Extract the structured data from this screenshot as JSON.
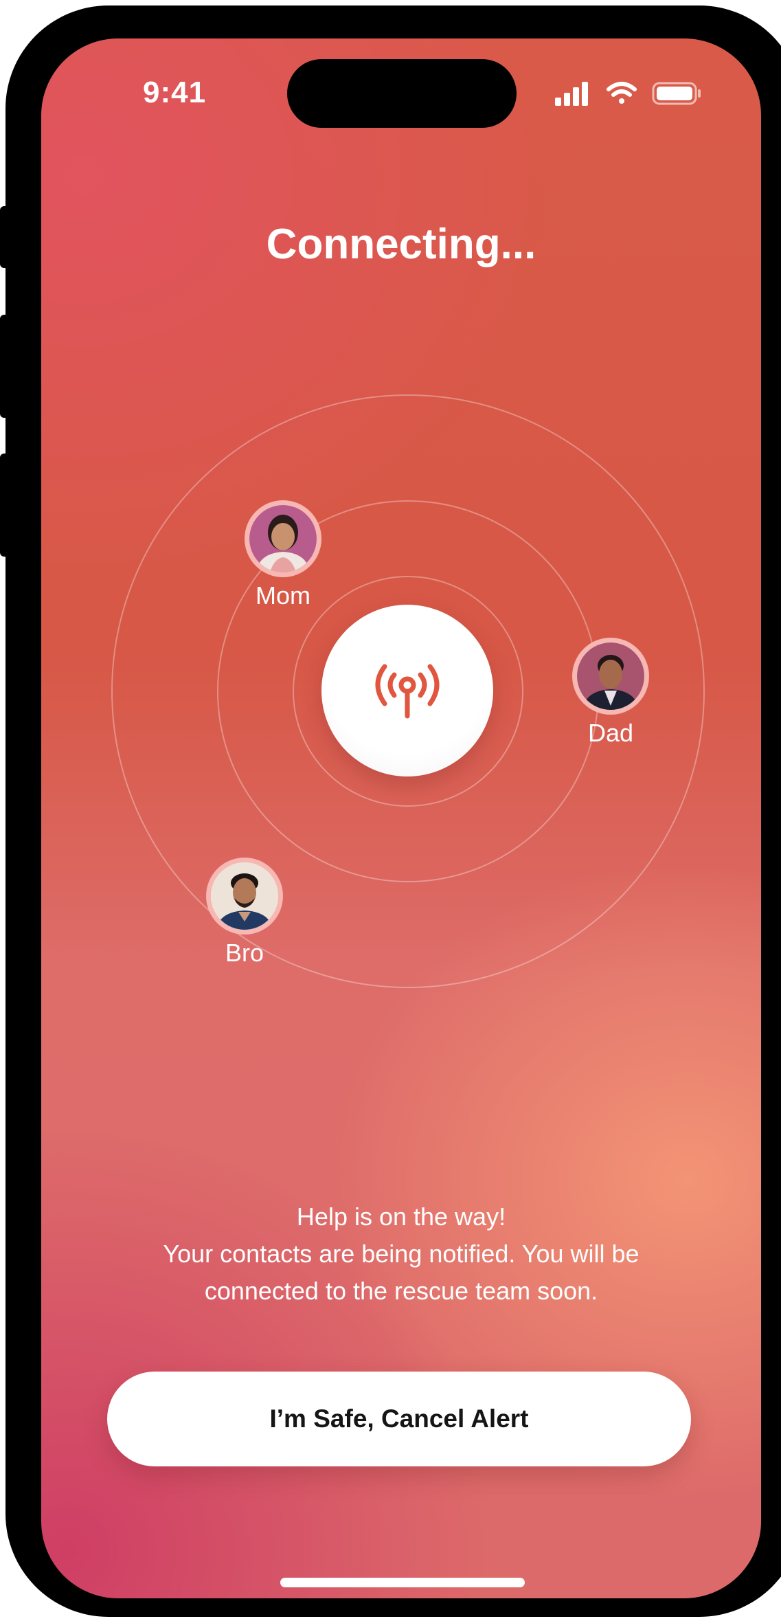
{
  "status_bar": {
    "time": "9:41",
    "icons": [
      "cellular-signal-icon",
      "wifi-icon",
      "battery-icon"
    ]
  },
  "title": "Connecting...",
  "center_button": {
    "icon": "broadcast-icon"
  },
  "contacts": [
    {
      "name": "Mom",
      "avatar": "mom-avatar"
    },
    {
      "name": "Dad",
      "avatar": "dad-avatar"
    },
    {
      "name": "Bro",
      "avatar": "bro-avatar"
    }
  ],
  "message": {
    "headline": "Help is on the way!",
    "line2": "Your contacts are being notified. You will be",
    "line3": "connected to the rescue team soon."
  },
  "cancel_button": {
    "label": "I’m Safe, Cancel Alert"
  },
  "colors": {
    "background_top": "#d95a48",
    "background_bottom_left": "#ce3c64",
    "background_glow": "#f49676",
    "accent": "#e0563f",
    "avatar_ring": "#f7b7b2",
    "button_bg": "#ffffff",
    "button_text": "#151515"
  }
}
